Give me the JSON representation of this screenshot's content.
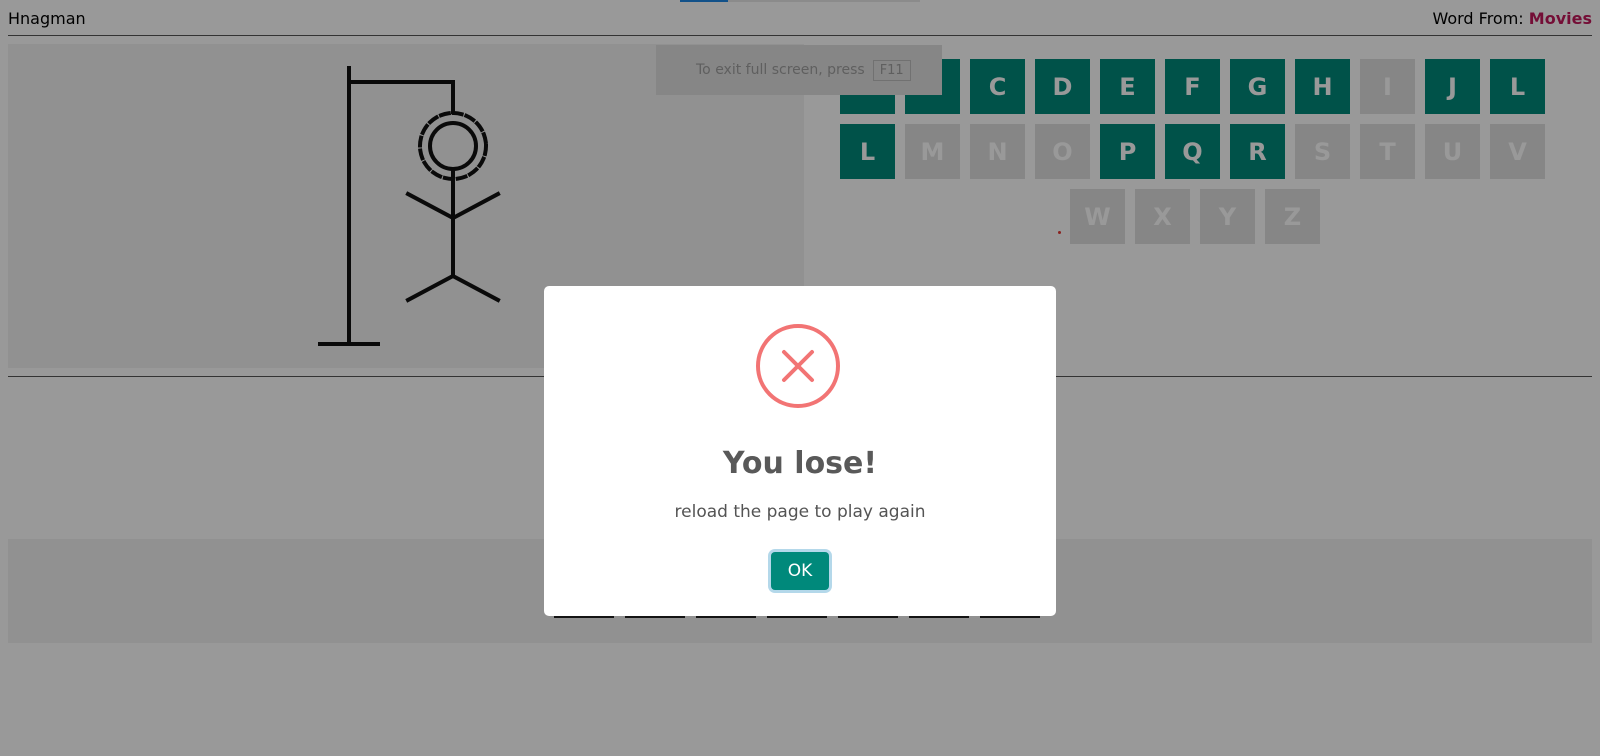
{
  "header": {
    "app_title": "Hnagman",
    "word_from_label": "Word From:",
    "category": "Movies"
  },
  "fullscreen_notice": {
    "text": "To exit full screen, press",
    "key": "F11"
  },
  "letters": {
    "row1": [
      {
        "char": "A",
        "state": "available"
      },
      {
        "char": "B",
        "state": "available"
      },
      {
        "char": "C",
        "state": "available"
      },
      {
        "char": "D",
        "state": "available"
      },
      {
        "char": "E",
        "state": "available"
      },
      {
        "char": "F",
        "state": "available"
      },
      {
        "char": "G",
        "state": "available"
      },
      {
        "char": "H",
        "state": "available"
      },
      {
        "char": "I",
        "state": "used"
      },
      {
        "char": "J",
        "state": "available"
      },
      {
        "char": "L",
        "state": "available"
      }
    ],
    "row2": [
      {
        "char": "L",
        "state": "available"
      },
      {
        "char": "M",
        "state": "used"
      },
      {
        "char": "N",
        "state": "used"
      },
      {
        "char": "O",
        "state": "used"
      },
      {
        "char": "P",
        "state": "available"
      },
      {
        "char": "Q",
        "state": "available"
      },
      {
        "char": "R",
        "state": "available"
      },
      {
        "char": "S",
        "state": "used"
      },
      {
        "char": "T",
        "state": "used"
      },
      {
        "char": "U",
        "state": "used"
      },
      {
        "char": "V",
        "state": "used"
      }
    ],
    "row3": [
      {
        "char": "W",
        "state": "used"
      },
      {
        "char": "X",
        "state": "used"
      },
      {
        "char": "Y",
        "state": "used"
      },
      {
        "char": "Z",
        "state": "used"
      }
    ]
  },
  "word": {
    "blank_count": 7
  },
  "modal": {
    "icon": "error-x-icon",
    "title": "You lose!",
    "text": "reload the page to play again",
    "ok_label": "OK"
  },
  "colors": {
    "available_letter": "#00897b",
    "used_letter": "#e0e0e0",
    "category": "#c2185b",
    "error": "#f27474"
  }
}
